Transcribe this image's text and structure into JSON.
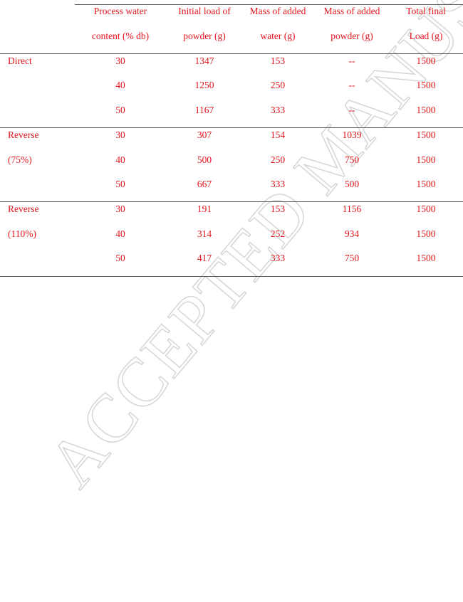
{
  "watermark": "ACCEPTED MANUSCRIPT",
  "text_color": "#e3141c",
  "table": {
    "headers": [
      {
        "line1": "",
        "line2": ""
      },
      {
        "line1": "Process water",
        "line2": "content (% db)"
      },
      {
        "line1": "Initial load of",
        "line2": "powder (g)"
      },
      {
        "line1": "Mass of added",
        "line2": "water (g)"
      },
      {
        "line1": "Mass of added",
        "line2": "powder (g)"
      },
      {
        "line1": "Total final",
        "line2": "Load (g)"
      }
    ],
    "groups": [
      {
        "label_line1": "Direct",
        "label_line2": "",
        "rows": [
          {
            "water_content": "30",
            "initial_powder": "1347",
            "added_water": "153",
            "added_powder": "--",
            "total": "1500"
          },
          {
            "water_content": "40",
            "initial_powder": "1250",
            "added_water": "250",
            "added_powder": "--",
            "total": "1500"
          },
          {
            "water_content": "50",
            "initial_powder": "1167",
            "added_water": "333",
            "added_powder": "--",
            "total": "1500"
          }
        ]
      },
      {
        "label_line1": "Reverse",
        "label_line2": "(75%)",
        "rows": [
          {
            "water_content": "30",
            "initial_powder": "307",
            "added_water": "154",
            "added_powder": "1039",
            "total": "1500"
          },
          {
            "water_content": "40",
            "initial_powder": "500",
            "added_water": "250",
            "added_powder": "750",
            "total": "1500"
          },
          {
            "water_content": "50",
            "initial_powder": "667",
            "added_water": "333",
            "added_powder": "500",
            "total": "1500"
          }
        ]
      },
      {
        "label_line1": "Reverse",
        "label_line2": "(110%)",
        "rows": [
          {
            "water_content": "30",
            "initial_powder": "191",
            "added_water": "153",
            "added_powder": "1156",
            "total": "1500"
          },
          {
            "water_content": "40",
            "initial_powder": "314",
            "added_water": "252",
            "added_powder": "934",
            "total": "1500"
          },
          {
            "water_content": "50",
            "initial_powder": "417",
            "added_water": "333",
            "added_powder": "750",
            "total": "1500"
          }
        ]
      }
    ]
  }
}
